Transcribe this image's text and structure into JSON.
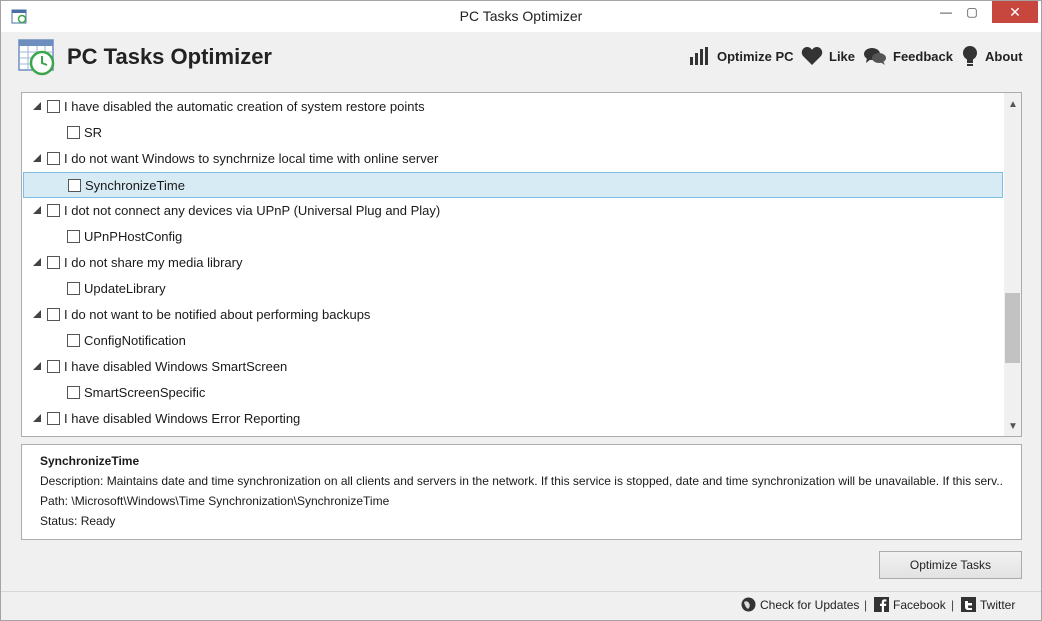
{
  "window": {
    "title": "PC Tasks Optimizer",
    "min_glyph": "—",
    "max_glyph": "▢",
    "close_glyph": "✕"
  },
  "header": {
    "app_name": "PC Tasks Optimizer",
    "nav": {
      "optimize": "Optimize PC",
      "like": "Like",
      "feedback": "Feedback",
      "about": "About"
    }
  },
  "tree": {
    "rows": [
      {
        "type": "parent",
        "label": "I have disabled the automatic creation of system restore points"
      },
      {
        "type": "child",
        "label": "SR"
      },
      {
        "type": "parent",
        "label": "I do not want Windows to synchrnize local time with online server"
      },
      {
        "type": "child",
        "label": "SynchronizeTime",
        "selected": true
      },
      {
        "type": "parent",
        "label": "I dot not connect any devices via UPnP (Universal Plug and Play)"
      },
      {
        "type": "child",
        "label": "UPnPHostConfig"
      },
      {
        "type": "parent",
        "label": "I do not share my media library"
      },
      {
        "type": "child",
        "label": "UpdateLibrary"
      },
      {
        "type": "parent",
        "label": "I do not want to be notified about performing backups"
      },
      {
        "type": "child",
        "label": "ConfigNotification"
      },
      {
        "type": "parent",
        "label": "I have disabled Windows SmartScreen"
      },
      {
        "type": "child",
        "label": "SmartScreenSpecific"
      },
      {
        "type": "parent",
        "label": "I have disabled Windows Error Reporting"
      }
    ]
  },
  "details": {
    "title": "SynchronizeTime",
    "description": "Description: Maintains date and time synchronization on all clients and servers in the network. If this service is stopped, date and time synchronization will be unavailable. If this serv...",
    "path": "Path: \\Microsoft\\Windows\\Time Synchronization\\SynchronizeTime",
    "status": "Status: Ready"
  },
  "actions": {
    "optimize_tasks": "Optimize Tasks"
  },
  "statusbar": {
    "check_updates": "Check for Updates",
    "facebook": "Facebook",
    "twitter": "Twitter",
    "separator": "|"
  },
  "colors": {
    "selection_bg": "#d7ebf5",
    "selection_border": "#7fbde4",
    "close_button": "#c7463e",
    "logo_green": "#3aa64a"
  }
}
